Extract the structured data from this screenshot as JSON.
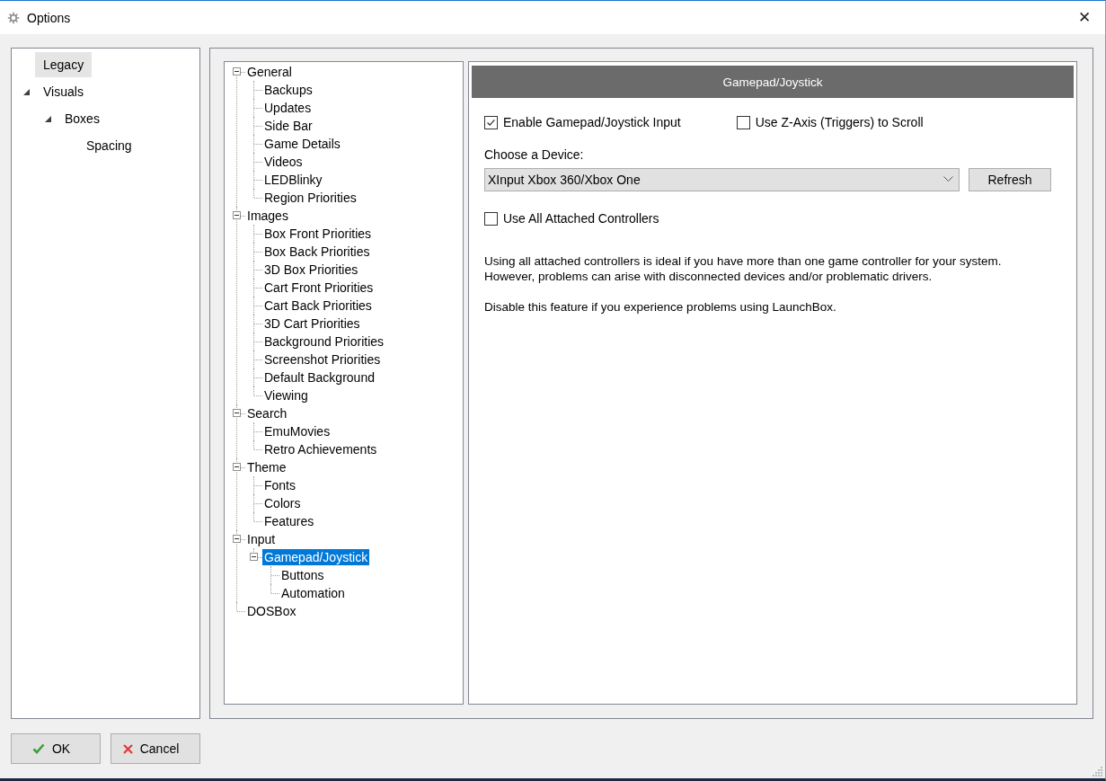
{
  "window": {
    "title": "Options",
    "close": "✕"
  },
  "sidebar": {
    "items": [
      {
        "label": "Legacy",
        "selected": true
      },
      {
        "label": "Visuals",
        "selected": false,
        "expanded": true,
        "children": [
          {
            "label": "Boxes",
            "selected": false,
            "expanded": true,
            "children": [
              {
                "label": "Spacing",
                "selected": false
              }
            ]
          }
        ]
      }
    ]
  },
  "categories": {
    "items": [
      {
        "label": "General",
        "selected": false,
        "expanded": true,
        "children": [
          {
            "label": "Backups",
            "selected": false
          },
          {
            "label": "Updates",
            "selected": false
          },
          {
            "label": "Side Bar",
            "selected": false
          },
          {
            "label": "Game Details",
            "selected": false
          },
          {
            "label": "Videos",
            "selected": false
          },
          {
            "label": "LEDBlinky",
            "selected": false
          },
          {
            "label": "Region Priorities",
            "selected": false
          }
        ]
      },
      {
        "label": "Images",
        "selected": false,
        "expanded": true,
        "children": [
          {
            "label": "Box Front Priorities",
            "selected": false
          },
          {
            "label": "Box Back Priorities",
            "selected": false
          },
          {
            "label": "3D Box Priorities",
            "selected": false
          },
          {
            "label": "Cart Front Priorities",
            "selected": false
          },
          {
            "label": "Cart Back Priorities",
            "selected": false
          },
          {
            "label": "3D Cart Priorities",
            "selected": false
          },
          {
            "label": "Background Priorities",
            "selected": false
          },
          {
            "label": "Screenshot Priorities",
            "selected": false
          },
          {
            "label": "Default Background",
            "selected": false
          },
          {
            "label": "Viewing",
            "selected": false
          }
        ]
      },
      {
        "label": "Search",
        "selected": false,
        "expanded": true,
        "children": [
          {
            "label": "EmuMovies",
            "selected": false
          },
          {
            "label": "Retro Achievements",
            "selected": false
          }
        ]
      },
      {
        "label": "Theme",
        "selected": false,
        "expanded": true,
        "children": [
          {
            "label": "Fonts",
            "selected": false
          },
          {
            "label": "Colors",
            "selected": false
          },
          {
            "label": "Features",
            "selected": false
          }
        ]
      },
      {
        "label": "Input",
        "selected": false,
        "expanded": true,
        "children": [
          {
            "label": "Gamepad/Joystick",
            "selected": true,
            "expanded": true,
            "children": [
              {
                "label": "Buttons",
                "selected": false
              },
              {
                "label": "Automation",
                "selected": false
              }
            ]
          }
        ]
      },
      {
        "label": "DOSBox",
        "selected": false
      }
    ]
  },
  "panel": {
    "header": "Gamepad/Joystick",
    "top_checkboxes": [
      {
        "label": "Enable Gamepad/Joystick Input",
        "checked": true
      },
      {
        "label": "Use Z-Axis (Triggers) to Scroll",
        "checked": false
      }
    ],
    "device_label": "Choose a Device:",
    "device_select": {
      "value": "XInput Xbox 360/Xbox One"
    },
    "refresh_button": "Refresh",
    "all_controllers": {
      "label": "Use All Attached Controllers",
      "checked": false
    },
    "paragraphs": [
      "Using all attached controllers is ideal if you have more than one game controller for your system. However, problems can arise with disconnected devices and/or problematic drivers.",
      "Disable this feature if you experience problems using LaunchBox."
    ]
  },
  "buttons": [
    {
      "kind": "ok",
      "label": "OK"
    },
    {
      "kind": "cancel",
      "label": "Cancel"
    }
  ]
}
